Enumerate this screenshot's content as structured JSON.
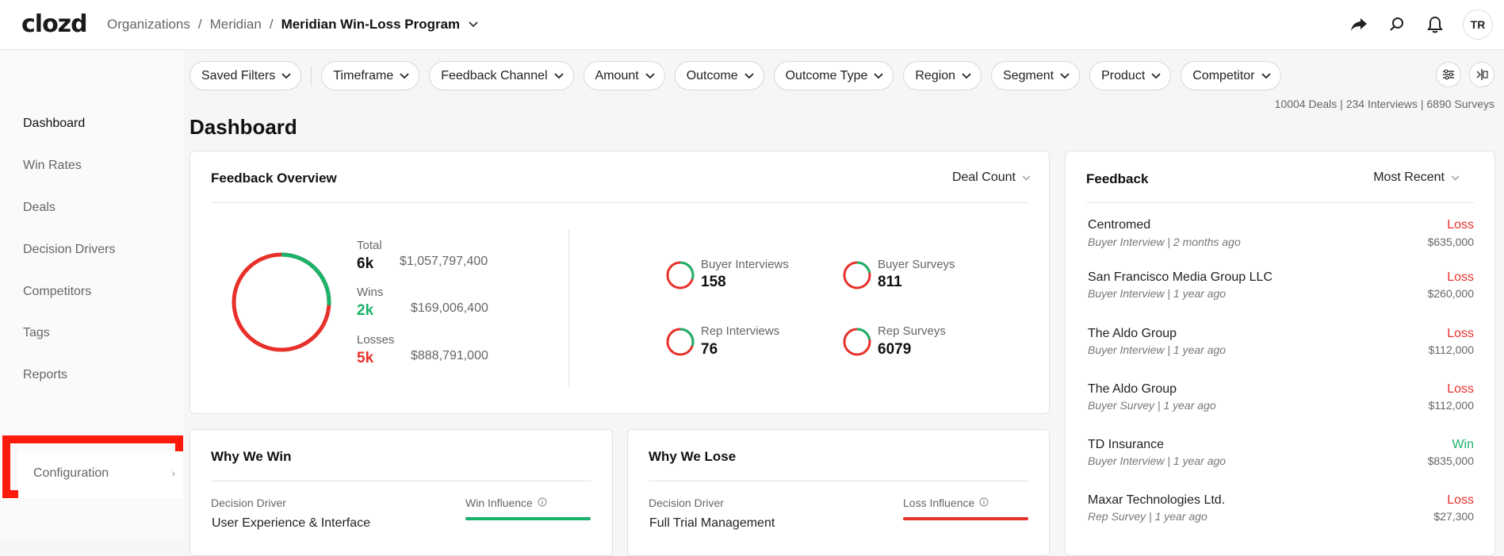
{
  "header": {
    "logo": "clozd",
    "breadcrumbs": [
      "Organizations",
      "Meridian",
      "Meridian Win-Loss Program"
    ],
    "avatar_initials": "TR"
  },
  "sidebar": {
    "items": [
      {
        "label": "Dashboard",
        "active": true
      },
      {
        "label": "Win Rates"
      },
      {
        "label": "Deals"
      },
      {
        "label": "Decision Drivers"
      },
      {
        "label": "Competitors"
      },
      {
        "label": "Tags"
      },
      {
        "label": "Reports"
      },
      {
        "label": "Configuration",
        "highlighted": true
      }
    ]
  },
  "filters": [
    "Saved Filters",
    "Timeframe",
    "Feedback Channel",
    "Amount",
    "Outcome",
    "Outcome Type",
    "Region",
    "Segment",
    "Product",
    "Competitor"
  ],
  "counts": "10004 Deals | 234 Interviews | 6890 Surveys",
  "page_title": "Dashboard",
  "overview": {
    "title": "Feedback Overview",
    "metric_dropdown": "Deal Count",
    "win_fraction": 0.26,
    "total_label": "Total",
    "total_count": "6k",
    "total_amount": "$1,057,797,400",
    "wins_label": "Wins",
    "wins_count": "2k",
    "wins_amount": "$169,006,400",
    "losses_label": "Losses",
    "losses_count": "5k",
    "losses_amount": "$888,791,000",
    "channels": [
      {
        "label": "Buyer Interviews",
        "value": "158",
        "win_fraction": 0.3
      },
      {
        "label": "Buyer Surveys",
        "value": "811",
        "win_fraction": 0.22
      },
      {
        "label": "Rep Interviews",
        "value": "76",
        "win_fraction": 0.3
      },
      {
        "label": "Rep Surveys",
        "value": "6079",
        "win_fraction": 0.22
      }
    ]
  },
  "why_win": {
    "title": "Why We Win",
    "col1": "Decision Driver",
    "col2": "Win Influence",
    "row1": "User Experience & Interface"
  },
  "why_lose": {
    "title": "Why We Lose",
    "col1": "Decision Driver",
    "col2": "Loss Influence",
    "row1": "Full Trial Management"
  },
  "feedback": {
    "title": "Feedback",
    "sort": "Most Recent",
    "items": [
      {
        "name": "Centromed",
        "type": "Buyer Interview",
        "when": "2 months ago",
        "outcome": "Loss",
        "amount": "$635,000"
      },
      {
        "name": "San Francisco Media Group LLC",
        "type": "Buyer Interview",
        "when": "1 year ago",
        "outcome": "Loss",
        "amount": "$260,000"
      },
      {
        "name": "The Aldo Group",
        "type": "Buyer Interview",
        "when": "1 year ago",
        "outcome": "Loss",
        "amount": "$112,000"
      },
      {
        "name": "The Aldo Group",
        "type": "Buyer Survey",
        "when": "1 year ago",
        "outcome": "Loss",
        "amount": "$112,000"
      },
      {
        "name": "TD Insurance",
        "type": "Buyer Interview",
        "when": "1 year ago",
        "outcome": "Win",
        "amount": "$835,000"
      },
      {
        "name": "Maxar Technologies Ltd.",
        "type": "Rep Survey",
        "when": "1 year ago",
        "outcome": "Loss",
        "amount": "$27,300"
      }
    ]
  },
  "colors": {
    "win": "#1ab26b",
    "loss": "#e8302a",
    "highlight": "#ff1a0e"
  }
}
